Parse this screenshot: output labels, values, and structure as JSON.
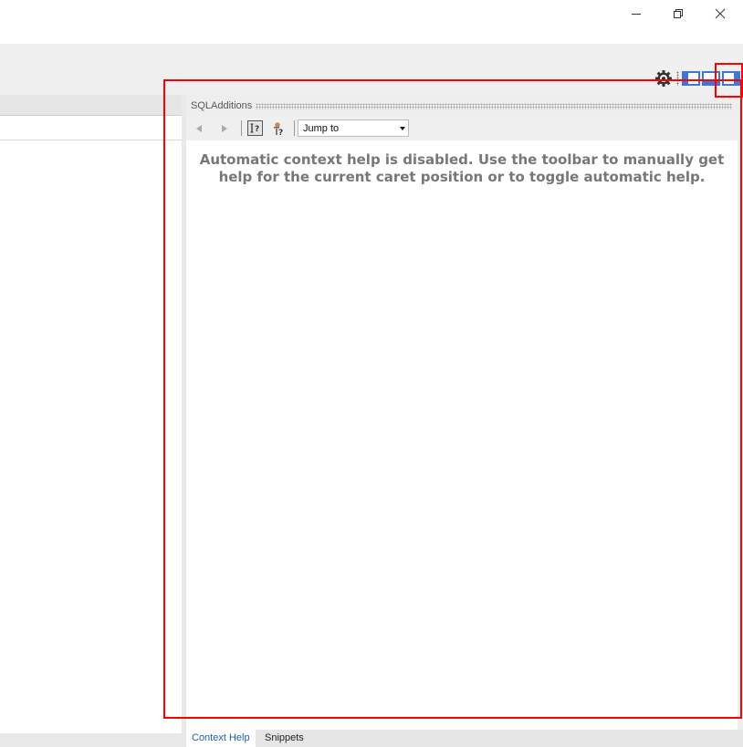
{
  "window": {
    "buttons": [
      {
        "name": "minimize",
        "icon": "minimize-icon"
      },
      {
        "name": "restore",
        "icon": "restore-icon"
      },
      {
        "name": "close",
        "icon": "close-icon"
      }
    ]
  },
  "toolbar": {
    "icons": [
      "gear-icon",
      "layout-left-icon",
      "layout-bottom-icon",
      "layout-right-icon"
    ],
    "accent": "#3c78d8"
  },
  "panel": {
    "title": "SQLAdditions",
    "toolbar": {
      "icons": [
        "back-icon",
        "forward-icon",
        "manual-help-icon",
        "auto-help-icon"
      ],
      "jump_to": {
        "value": "Jump to"
      }
    },
    "message": "Automatic context help is disabled. Use the toolbar to manually get help for the current caret position or to toggle automatic help.",
    "tabs": [
      {
        "label": "Context Help",
        "active": true
      },
      {
        "label": "Snippets",
        "active": false
      }
    ]
  },
  "annotation": {
    "color": "#ff0000"
  }
}
